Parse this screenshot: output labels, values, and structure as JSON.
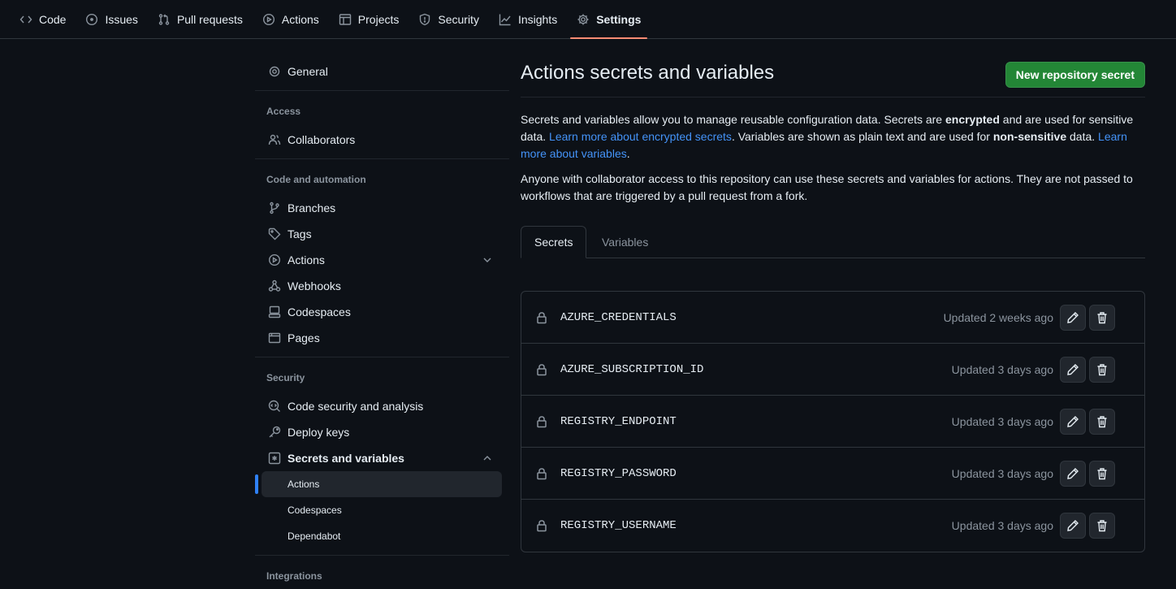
{
  "topnav": {
    "tabs": [
      {
        "label": "Code",
        "icon": "code-icon"
      },
      {
        "label": "Issues",
        "icon": "issue-opened-icon"
      },
      {
        "label": "Pull requests",
        "icon": "git-pull-request-icon"
      },
      {
        "label": "Actions",
        "icon": "play-icon"
      },
      {
        "label": "Projects",
        "icon": "table-icon"
      },
      {
        "label": "Security",
        "icon": "shield-icon"
      },
      {
        "label": "Insights",
        "icon": "graph-icon"
      },
      {
        "label": "Settings",
        "icon": "gear-icon"
      }
    ],
    "selected": "Settings",
    "accent": "#fd8c73"
  },
  "sidebar": {
    "general": "General",
    "access_heading": "Access",
    "collaborators": "Collaborators",
    "code_automation_heading": "Code and automation",
    "branches": "Branches",
    "tags": "Tags",
    "actions": "Actions",
    "webhooks": "Webhooks",
    "codespaces": "Codespaces",
    "pages": "Pages",
    "security_heading": "Security",
    "code_security": "Code security and analysis",
    "deploy_keys": "Deploy keys",
    "secrets_variables": "Secrets and variables",
    "sub_actions": "Actions",
    "sub_codespaces": "Codespaces",
    "sub_dependabot": "Dependabot",
    "integrations_heading": "Integrations",
    "active_indicator_color": "#2f81f7"
  },
  "main": {
    "title": "Actions secrets and variables",
    "new_secret_button": "New repository secret",
    "desc1": {
      "t1": "Secrets and variables allow you to manage reusable configuration data. Secrets are ",
      "b1": "encrypted",
      "t2": " and are used for sensitive data. ",
      "link1": "Learn more about encrypted secrets",
      "t3": ". Variables are shown as plain text and are used for ",
      "b2": "non-sensitive",
      "t4": " data. ",
      "link2": "Learn more about variables",
      "t5": "."
    },
    "desc2": "Anyone with collaborator access to this repository can use these secrets and variables for actions. They are not passed to workflows that are triggered by a pull request from a fork.",
    "tabs": {
      "secrets": "Secrets",
      "variables": "Variables"
    },
    "secrets": [
      {
        "name": "AZURE_CREDENTIALS",
        "updated": "Updated 2 weeks ago"
      },
      {
        "name": "AZURE_SUBSCRIPTION_ID",
        "updated": "Updated 3 days ago"
      },
      {
        "name": "REGISTRY_ENDPOINT",
        "updated": "Updated 3 days ago"
      },
      {
        "name": "REGISTRY_PASSWORD",
        "updated": "Updated 3 days ago"
      },
      {
        "name": "REGISTRY_USERNAME",
        "updated": "Updated 3 days ago"
      }
    ],
    "primary_color": "#238636",
    "link_color": "#4493f8"
  }
}
